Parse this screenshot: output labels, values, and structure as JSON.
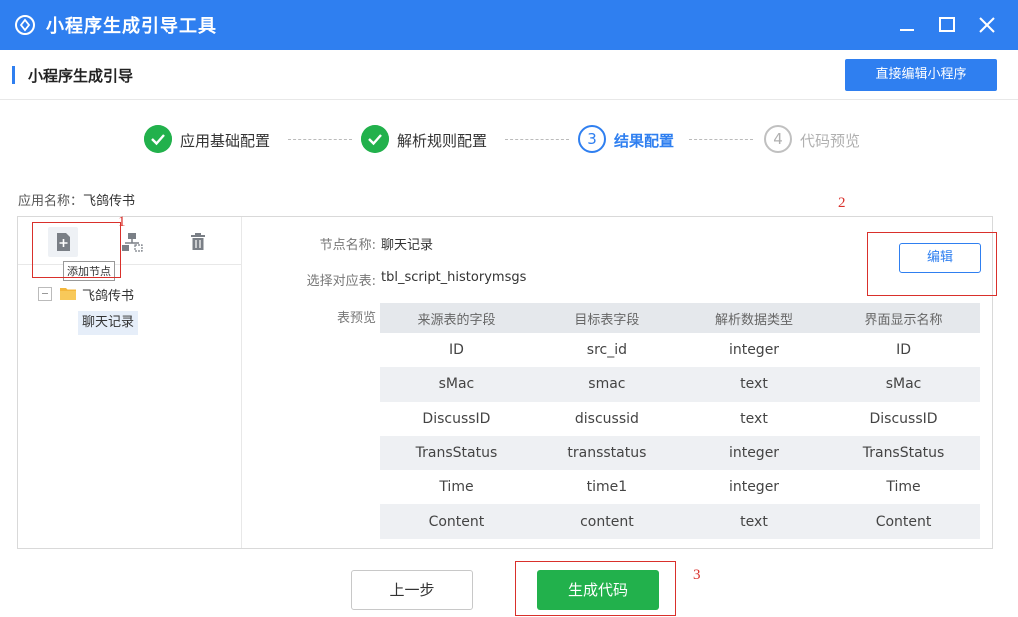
{
  "window": {
    "title": "小程序生成引导工具"
  },
  "header": {
    "title": "小程序生成引导",
    "edit_direct_label": "直接编辑小程序"
  },
  "steps": [
    {
      "number": "",
      "label": "应用基础配置",
      "state": "done"
    },
    {
      "number": "",
      "label": "解析规则配置",
      "state": "done"
    },
    {
      "number": "3",
      "label": "结果配置",
      "state": "active"
    },
    {
      "number": "4",
      "label": "代码预览",
      "state": "pending"
    }
  ],
  "app_name": {
    "label": "应用名称：",
    "value": "飞鸽传书"
  },
  "toolbar": {
    "tooltip": "添加节点",
    "icons": [
      "add-node-icon",
      "tree-structure-icon",
      "trash-icon"
    ]
  },
  "tree": {
    "root": "飞鸽传书",
    "child": "聊天记录"
  },
  "detail": {
    "node_name_label": "节点名称:",
    "node_name_value": "聊天记录",
    "table_label": "选择对应表:",
    "table_value": "tbl_script_historymsgs",
    "preview_label": "表预览",
    "edit_label": "编辑"
  },
  "preview_table": {
    "headers": [
      "来源表的字段",
      "目标表字段",
      "解析数据类型",
      "界面显示名称"
    ],
    "rows": [
      [
        "ID",
        "src_id",
        "integer",
        "ID"
      ],
      [
        "sMac",
        "smac",
        "text",
        "sMac"
      ],
      [
        "DiscussID",
        "discussid",
        "text",
        "DiscussID"
      ],
      [
        "TransStatus",
        "transstatus",
        "integer",
        "TransStatus"
      ],
      [
        "Time",
        "time1",
        "integer",
        "Time"
      ],
      [
        "Content",
        "content",
        "text",
        "Content"
      ]
    ]
  },
  "footer": {
    "prev_label": "上一步",
    "generate_label": "生成代码"
  },
  "annotations": {
    "one": "1",
    "two": "2",
    "three": "3"
  },
  "colors": {
    "primary": "#2f7ff0",
    "success": "#22b14c",
    "annotation": "#d9302b"
  }
}
